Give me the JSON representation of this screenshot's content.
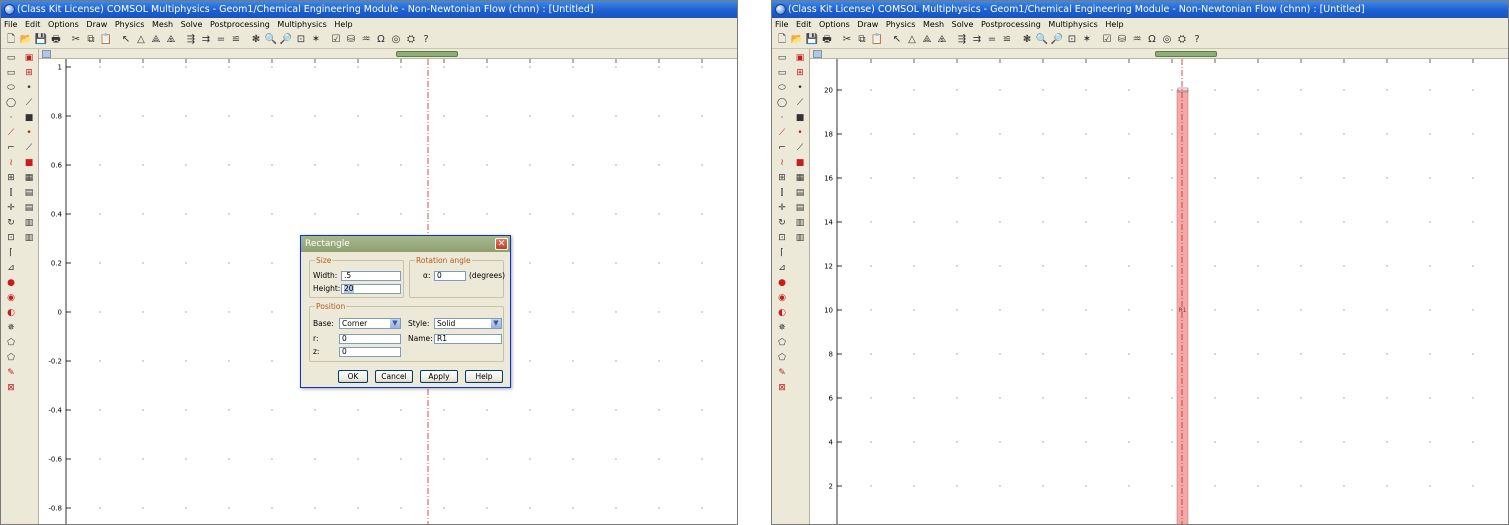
{
  "left_window": {
    "title": "(Class Kit License) COMSOL Multiphysics - Geom1/Chemical Engineering Module - Non-Newtonian Flow (chnn) : [Untitled]",
    "menu": [
      "File",
      "Edit",
      "Options",
      "Draw",
      "Physics",
      "Mesh",
      "Solve",
      "Postprocessing",
      "Multiphysics",
      "Help"
    ],
    "y_ticks": [
      "1",
      "0.8",
      "0.6",
      "0.4",
      "0.2",
      "0",
      "-0.2",
      "-0.4",
      "-0.6",
      "-0.8"
    ]
  },
  "right_window": {
    "title": "(Class Kit License) COMSOL Multiphysics - Geom1/Chemical Engineering Module - Non-Newtonian Flow (chnn) : [Untitled]",
    "menu": [
      "File",
      "Edit",
      "Options",
      "Draw",
      "Physics",
      "Mesh",
      "Solve",
      "Postprocessing",
      "Multiphysics",
      "Help"
    ],
    "y_ticks": [
      "20",
      "18",
      "16",
      "14",
      "12",
      "10",
      "8",
      "6",
      "4",
      "2"
    ],
    "object_label": "R1",
    "object_color": "#f4a9a9"
  },
  "dialog": {
    "title": "Rectangle",
    "size_group": "Size",
    "width_label": "Width:",
    "width_value": ".5",
    "height_label": "Height:",
    "height_value": "20",
    "rotation_group": "Rotation angle",
    "alpha_label": "α:",
    "alpha_value": "0",
    "degrees_label": "(degrees)",
    "position_group": "Position",
    "base_label": "Base:",
    "base_value": "Corner",
    "r_label": "r:",
    "r_value": "0",
    "z_label": "z:",
    "z_value": "0",
    "style_label": "Style:",
    "style_value": "Solid",
    "name_label": "Name:",
    "name_value": "R1",
    "ok": "OK",
    "cancel": "Cancel",
    "apply": "Apply",
    "help": "Help"
  },
  "colors": {
    "axis_line": "#d02525",
    "grid_dot": "#9a9a9a"
  }
}
